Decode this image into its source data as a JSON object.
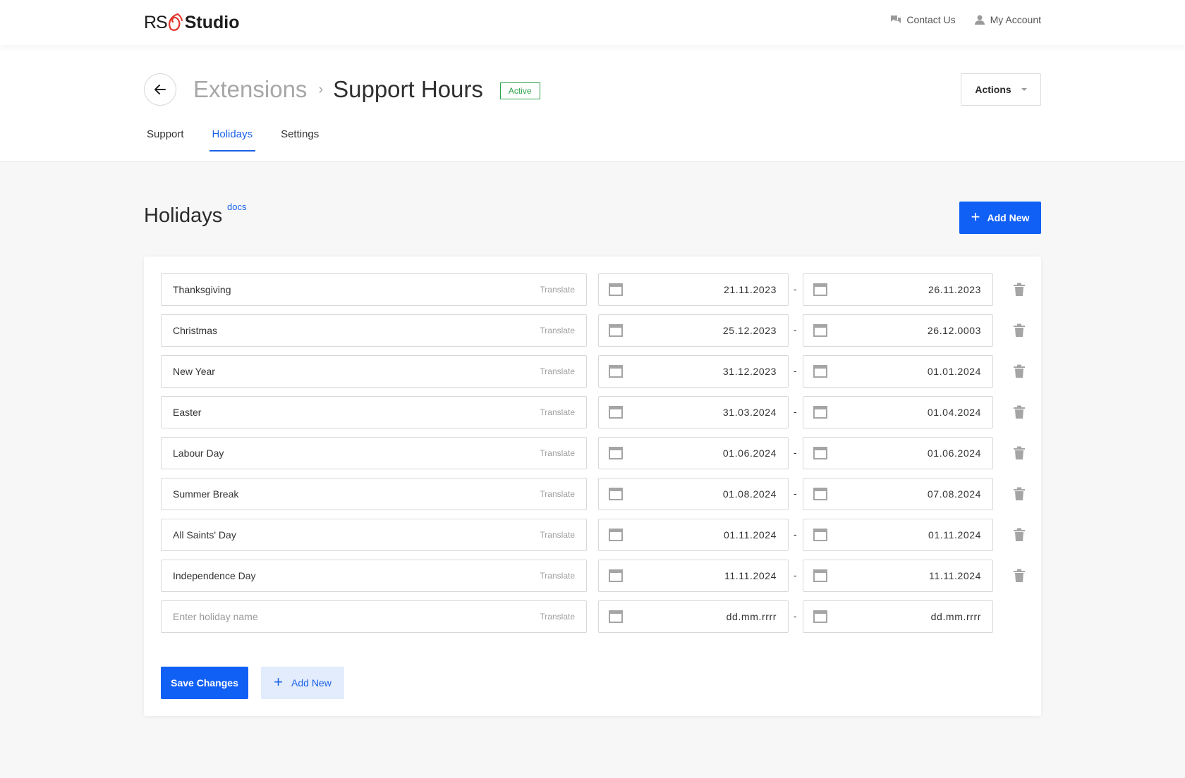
{
  "brand": {
    "rs": "RS",
    "studio": "Studio",
    "accent": "#e0342a"
  },
  "topnav": {
    "contact": "Contact Us",
    "account": "My Account"
  },
  "header": {
    "parent": "Extensions",
    "current": "Support Hours",
    "badge": "Active",
    "actions": "Actions"
  },
  "tabs": [
    {
      "label": "Support",
      "active": false
    },
    {
      "label": "Holidays",
      "active": true
    },
    {
      "label": "Settings",
      "active": false
    }
  ],
  "section": {
    "title": "Holidays",
    "docs": "docs",
    "add_new": "Add New"
  },
  "holidays": [
    {
      "name": "Thanksgiving",
      "from": "21.11.2023",
      "to": "26.11.2023"
    },
    {
      "name": "Christmas",
      "from": "25.12.2023",
      "to": "26.12.0003"
    },
    {
      "name": "New Year",
      "from": "31.12.2023",
      "to": "01.01.2024"
    },
    {
      "name": "Easter",
      "from": "31.03.2024",
      "to": "01.04.2024"
    },
    {
      "name": "Labour Day",
      "from": "01.06.2024",
      "to": "01.06.2024"
    },
    {
      "name": "Summer Break",
      "from": "01.08.2024",
      "to": "07.08.2024"
    },
    {
      "name": "All Saints' Day",
      "from": "01.11.2024",
      "to": "01.11.2024"
    },
    {
      "name": "Independence Day",
      "from": "11.11.2024",
      "to": "11.11.2024"
    }
  ],
  "new_row": {
    "name_placeholder": "Enter holiday name",
    "from_placeholder": "dd.mm.rrrr",
    "to_placeholder": "dd.mm.rrrr"
  },
  "labels": {
    "translate": "Translate",
    "dash": "-"
  },
  "footer": {
    "save": "Save Changes",
    "add_new": "Add New"
  },
  "colors": {
    "primary": "#1160f6",
    "active_badge": "#2da24a",
    "link": "#1a62e8"
  }
}
